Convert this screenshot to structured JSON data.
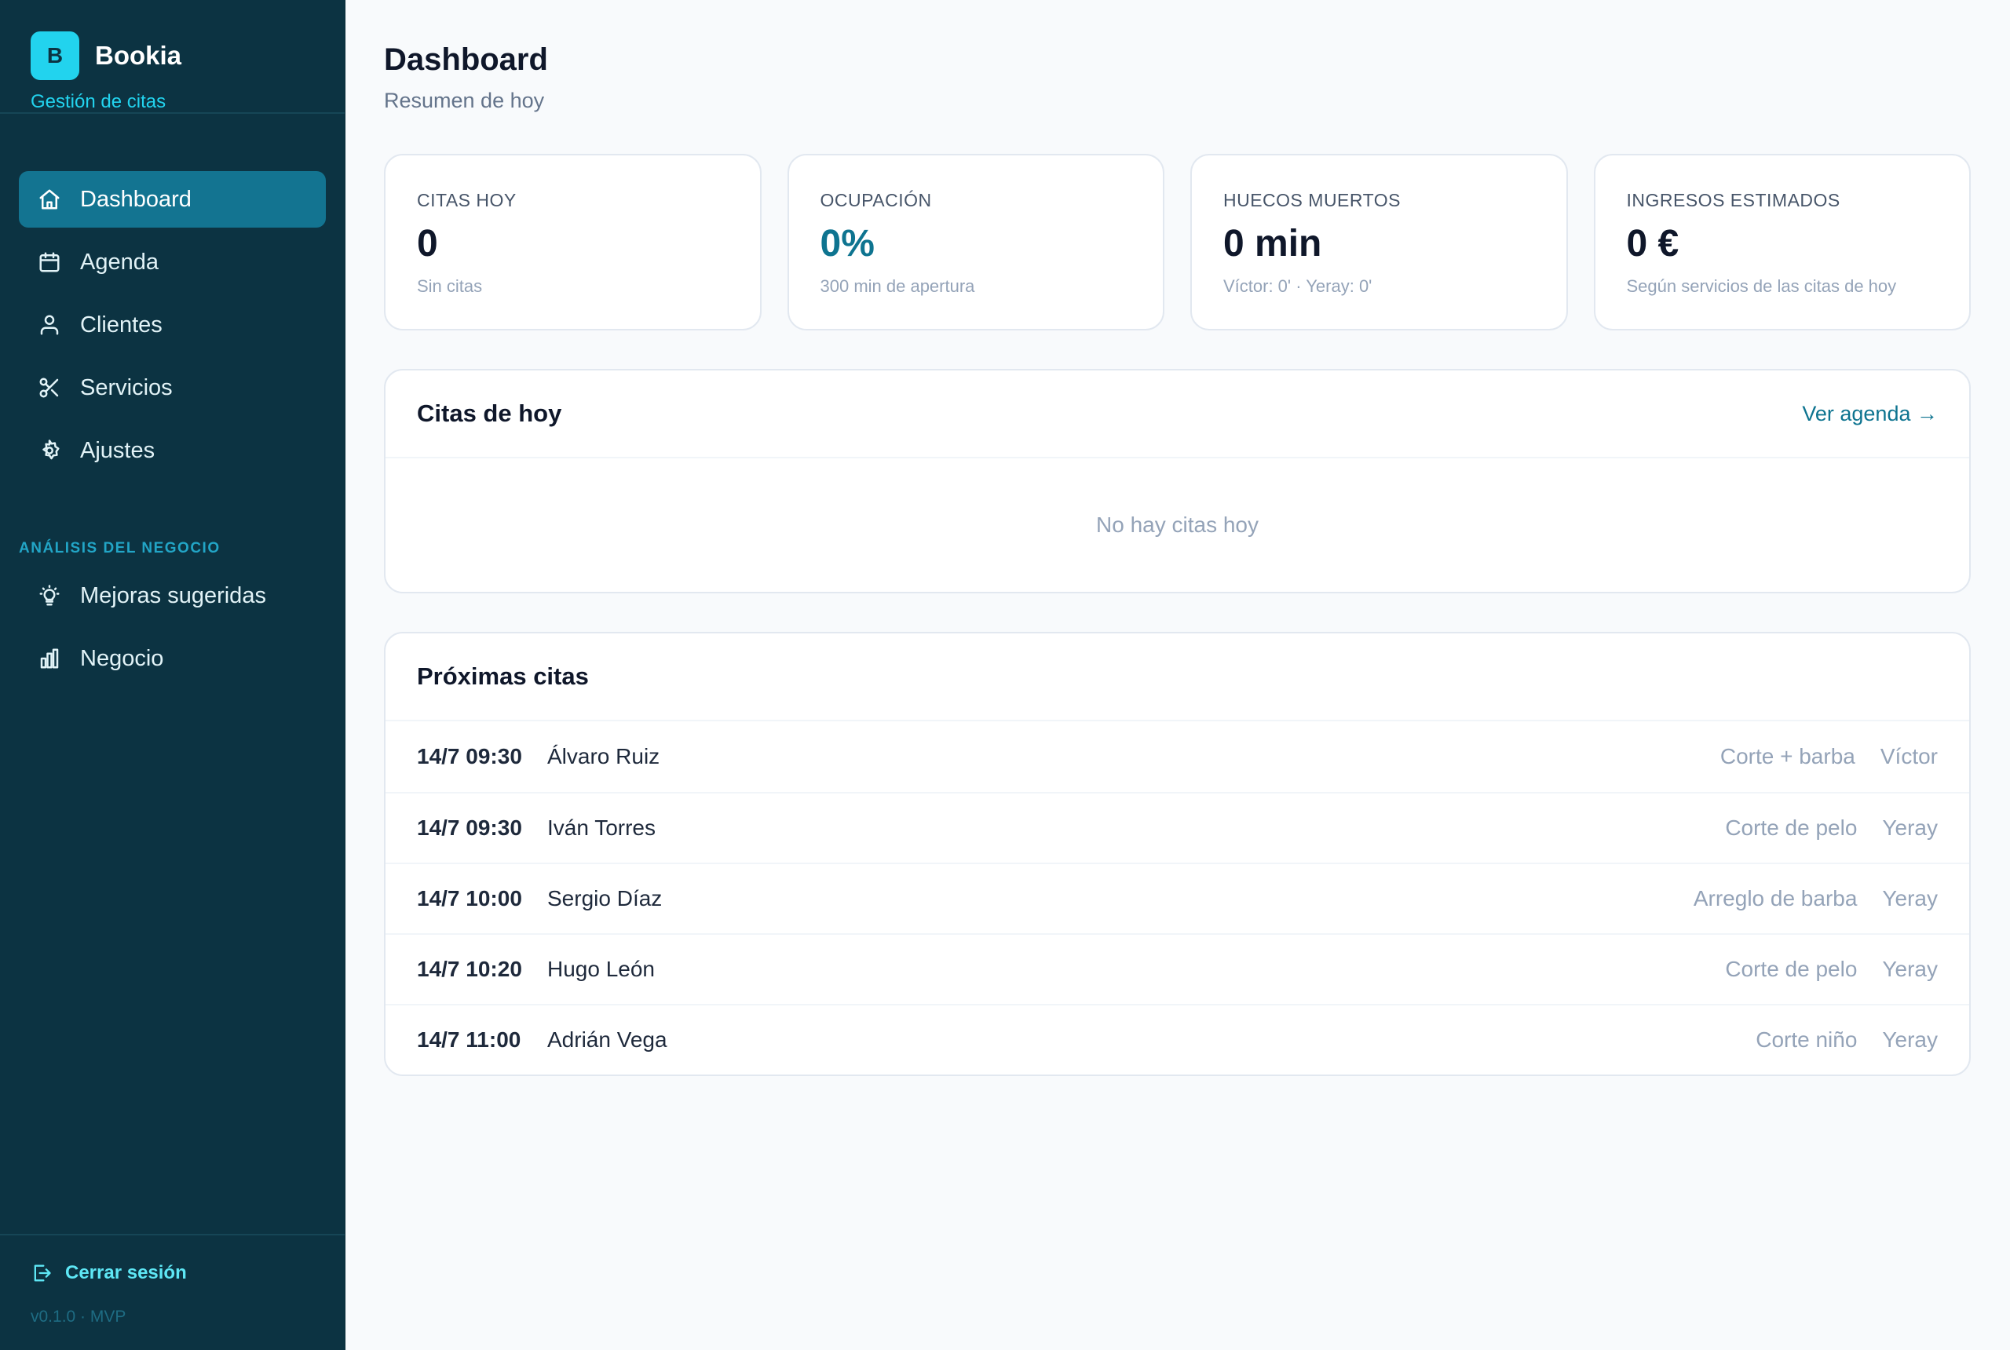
{
  "brand": {
    "logo_letter": "B",
    "name": "Bookia",
    "subtitle": "Gestión de citas"
  },
  "sidebar": {
    "items": [
      {
        "label": "Dashboard",
        "icon": "home-icon",
        "active": true
      },
      {
        "label": "Agenda",
        "icon": "calendar-icon"
      },
      {
        "label": "Clientes",
        "icon": "users-icon"
      },
      {
        "label": "Servicios",
        "icon": "scissors-icon"
      },
      {
        "label": "Ajustes",
        "icon": "gear-icon"
      }
    ],
    "section_label": "ANÁLISIS DEL NEGOCIO",
    "analysis_items": [
      {
        "label": "Mejoras sugeridas",
        "icon": "lightbulb-icon"
      },
      {
        "label": "Negocio",
        "icon": "bar-chart-icon"
      }
    ],
    "logout_label": "Cerrar sesión",
    "version": "v0.1.0 · MVP"
  },
  "header": {
    "title": "Dashboard",
    "subtitle": "Resumen de hoy"
  },
  "kpis": [
    {
      "label": "CITAS HOY",
      "value": "0",
      "note": "Sin citas"
    },
    {
      "label": "OCUPACIÓN",
      "value": "0%",
      "note": "300 min de apertura"
    },
    {
      "label": "HUECOS MUERTOS",
      "value": "0 min",
      "note": "Víctor: 0' · Yeray: 0'"
    },
    {
      "label": "INGRESOS ESTIMADOS",
      "value": "0 €",
      "note": "Según servicios de las citas de hoy"
    }
  ],
  "today": {
    "title": "Citas de hoy",
    "link": "Ver agenda →",
    "empty": "No hay citas hoy"
  },
  "upcoming": {
    "title": "Próximas citas",
    "rows": [
      {
        "time": "14/7 09:30",
        "client": "Álvaro Ruiz",
        "service": "Corte + barba",
        "staff": "Víctor"
      },
      {
        "time": "14/7 09:30",
        "client": "Iván Torres",
        "service": "Corte de pelo",
        "staff": "Yeray"
      },
      {
        "time": "14/7 10:00",
        "client": "Sergio Díaz",
        "service": "Arreglo de barba",
        "staff": "Yeray"
      },
      {
        "time": "14/7 10:20",
        "client": "Hugo León",
        "service": "Corte de pelo",
        "staff": "Yeray"
      },
      {
        "time": "14/7 11:00",
        "client": "Adrián Vega",
        "service": "Corte niño",
        "staff": "Yeray"
      }
    ]
  },
  "colors": {
    "sidebar": "#0c3342",
    "active": "#137491",
    "accent": "#22d3ee",
    "link": "#0e7490"
  }
}
